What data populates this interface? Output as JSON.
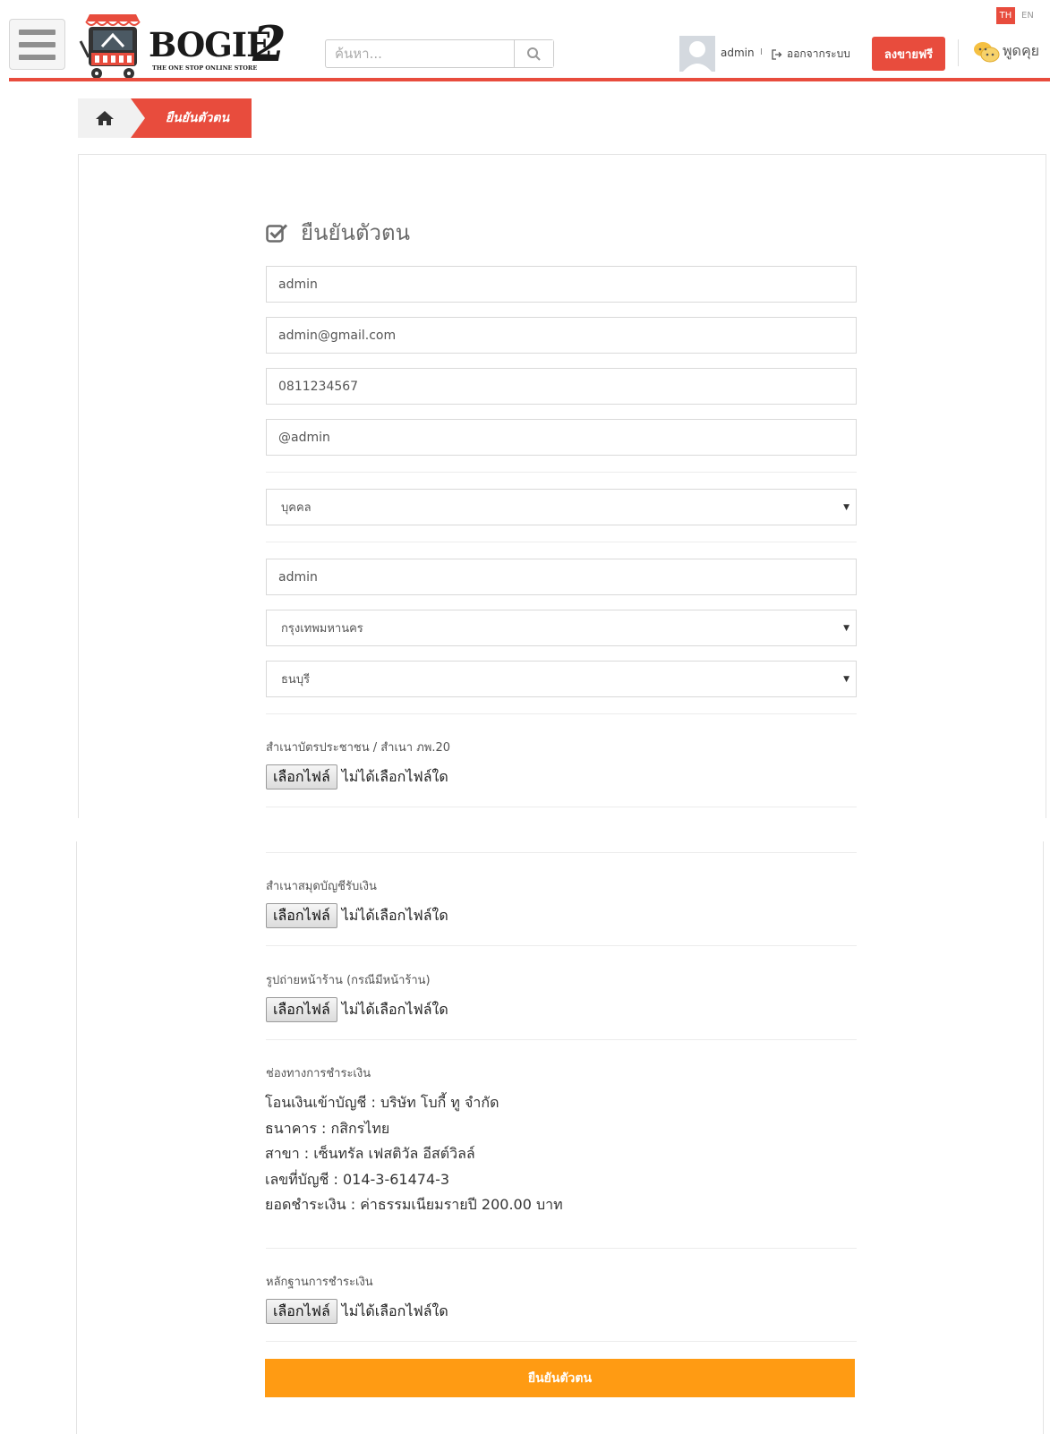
{
  "header": {
    "logo_text": "BOGIE",
    "logo_number": "2",
    "logo_tagline": "THE ONE STOP ONLINE STORE",
    "search_placeholder": "ค้นหา...",
    "user_name": "admin",
    "separator": "I",
    "logout_label": "ออกจากระบบ",
    "sell_button_label": "ลงขายฟรี",
    "chat_label": "พูดคุย",
    "lang_active": "TH",
    "lang_other": "EN",
    "accent_color": "#e84c3d"
  },
  "breadcrumb": {
    "current": "ยืนยันตัวตน"
  },
  "form": {
    "title": "ยืนยันตัวตน",
    "name_value": "admin",
    "email_value": "admin@gmail.com",
    "phone_value": "0811234567",
    "line_id_value": "@admin",
    "person_type_value": "บุคคล",
    "shop_name_value": "admin",
    "province_value": "กรุงเทพมหานคร",
    "district_value": "ธนบุรี",
    "id_card_label": "สำเนาบัตรประชาชน / สำเนา ภพ.20",
    "bank_book_label": "สำเนาสมุดบัญชีรับเงิน",
    "storefront_label": "รูปถ่ายหน้าร้าน (กรณีมีหน้าร้าน)",
    "payment_channel_label": "ช่องทางการชำระเงิน",
    "payment_proof_label": "หลักฐานการชำระเงิน",
    "file_button_label": "เลือกไฟล์",
    "file_empty_text": "ไม่ได้เลือกไฟล์ใด",
    "submit_label": "ยืนยันตัวตน",
    "submit_color": "#ff9b13"
  },
  "payment": {
    "transfer": "โอนเงินเข้าบัญชี : บริษัท โบกี้ ทู จำกัด",
    "bank": "ธนาคาร : กสิกรไทย",
    "branch": "สาขา : เซ็นทรัล เฟสติวัล อีสต์วิลล์",
    "account_no": "เลขที่บัญชี : 014-3-61474-3",
    "amount": "ยอดชำระเงิน : ค่าธรรมเนียมรายปี 200.00 บาท"
  }
}
